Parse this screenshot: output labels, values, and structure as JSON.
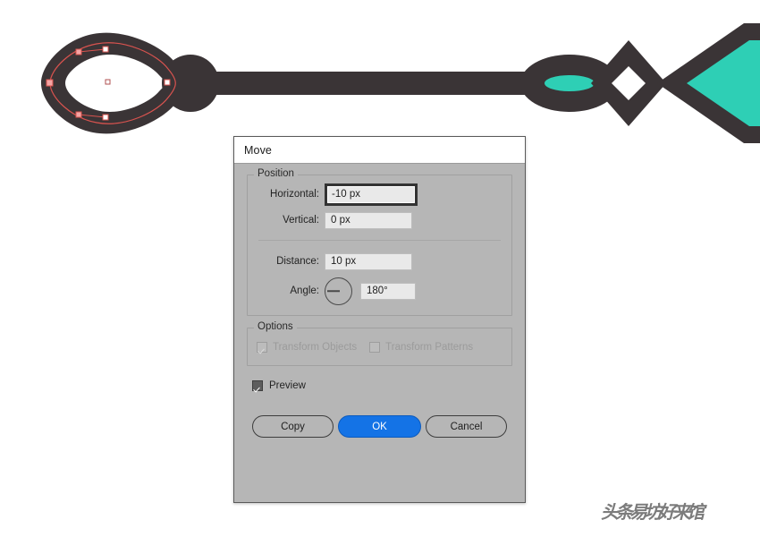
{
  "app": {
    "canvas_background": "#ffffff"
  },
  "artwork": {
    "name": "arrow-key-vector-artwork",
    "dark_color": "#3a3436",
    "accent_color": "#2ecfb5",
    "path_color": "#d9534f",
    "anchor_fill": "#f4c8c8",
    "description": "Ornamental arrow with teardrop loop handle, selected path shown",
    "selection_visible": true
  },
  "dialog": {
    "title": "Move",
    "position_group": {
      "legend": "Position",
      "fields": [
        {
          "label": "Horizontal:",
          "value": "-10 px",
          "focused": true
        },
        {
          "label": "Vertical:",
          "value": "0 px",
          "focused": false
        }
      ],
      "distance": {
        "label": "Distance:",
        "value": "10 px"
      },
      "angle": {
        "label": "Angle:",
        "value": "180°",
        "dial_degrees": 180
      }
    },
    "options_group": {
      "legend": "Options",
      "checkboxes": [
        {
          "label": "Transform Objects",
          "checked": true,
          "disabled": true
        },
        {
          "label": "Transform Patterns",
          "checked": false,
          "disabled": true
        }
      ]
    },
    "preview": {
      "label": "Preview",
      "checked": true
    },
    "buttons": {
      "copy": "Copy",
      "ok": "OK",
      "cancel": "Cancel",
      "primary_color": "#1473e6"
    }
  },
  "watermark": {
    "text": "头条易坊好来馆"
  }
}
